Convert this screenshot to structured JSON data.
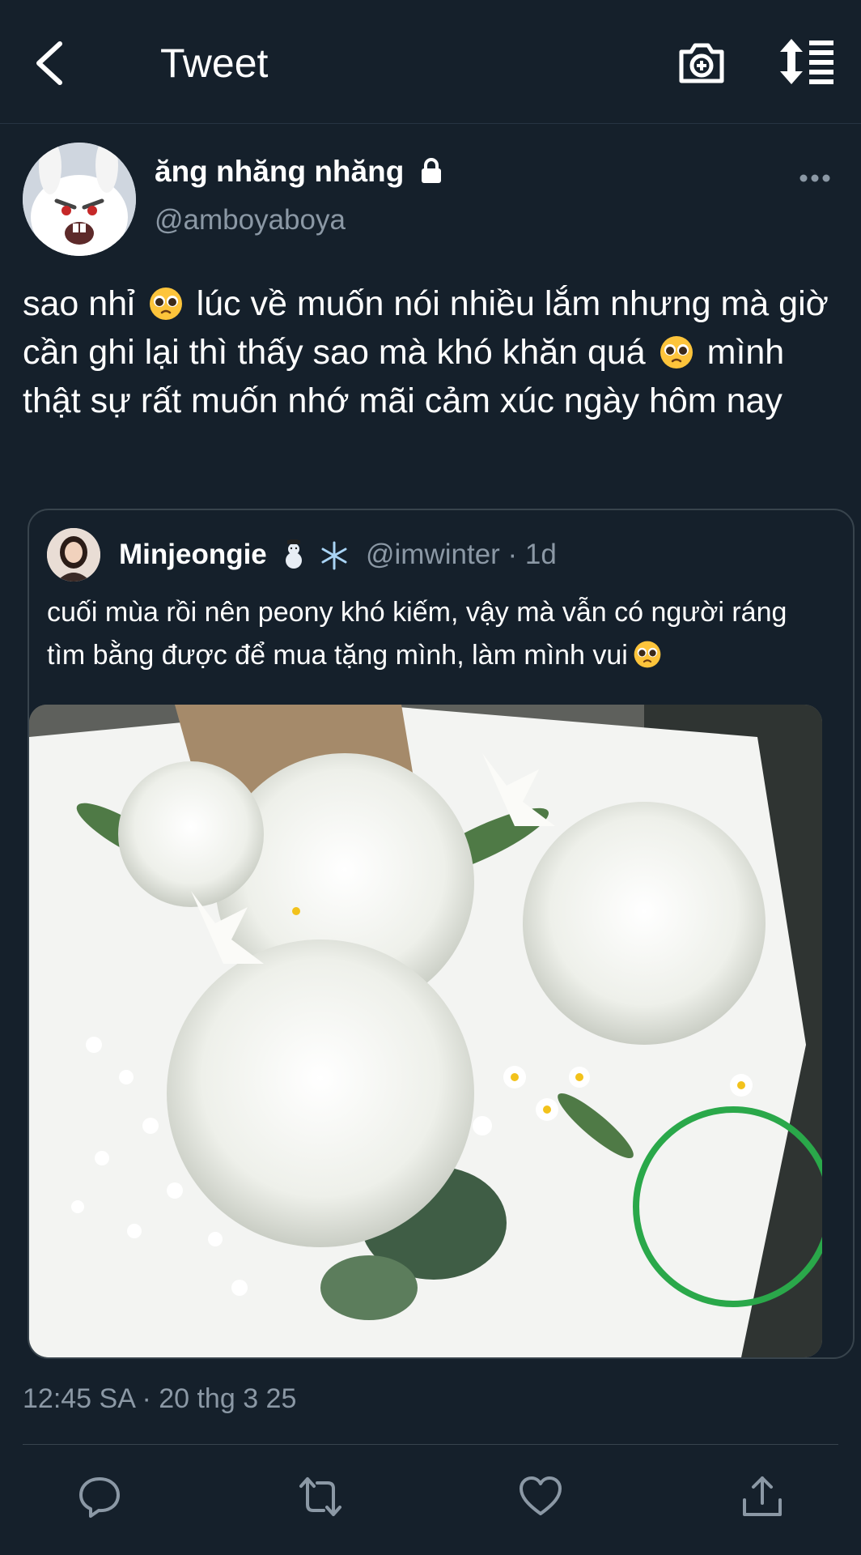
{
  "header": {
    "title": "Tweet",
    "back_icon": "chevron-left-icon",
    "camera_icon": "camera-plus-icon",
    "sort_icon": "sort-timeline-icon"
  },
  "tweet": {
    "display_name": "ăng nhăng nhăng",
    "handle": "@amboyaboya",
    "protected_icon": "lock-icon",
    "text": "sao nhỉ 🥺 lúc về muốn nói nhiều lắm nhưng mà giờ cần ghi lại thì thấy sao mà khó khăn quá 🥺 mình thật sự rất muốn nhớ mãi cảm xúc ngày hôm nay",
    "text_parts": {
      "a": "sao nhỉ",
      "b": "lúc về muốn nói nhiều lắm nhưng mà giờ cần ghi lại thì thấy sao mà khó khăn quá",
      "c": "mình thật sự rất muốn nhớ mãi cảm xúc ngày hôm nay"
    },
    "timestamp": "12:45 SA · 20 thg 3 25"
  },
  "quoted_tweet": {
    "display_name": "Minjeongie",
    "name_emojis": "☃️❄️",
    "handle_and_time": "@imwinter · 1d",
    "text": "cuối mùa rồi nên peony khó kiếm, vậy mà vẫn có người ráng tìm bằng được để mua tặng mình, làm mình vui 🥺",
    "text_main": "cuối mùa rồi nên peony khó kiếm, vậy mà vẫn có người ráng tìm bằng được để mua tặng mình, làm mình vui",
    "photo_alt": "bouquet of white peonies, lilies and baby's breath"
  },
  "actions": {
    "reply_icon": "reply-icon",
    "retweet_icon": "retweet-icon",
    "like_icon": "heart-icon",
    "share_icon": "share-icon"
  },
  "colors": {
    "background": "#15202b",
    "secondary_text": "#8b98a5",
    "border": "#38444d"
  }
}
